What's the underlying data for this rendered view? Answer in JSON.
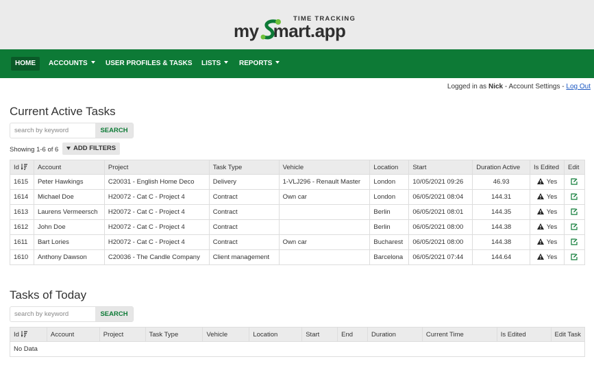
{
  "brand": {
    "tagline": "TIME TRACKING",
    "name": "mysmart.app",
    "name_prefix": "my",
    "name_suffix": "mart.app",
    "accent_color": "#0d7a36"
  },
  "nav": {
    "items": [
      {
        "label": "HOME",
        "active": true,
        "dropdown": false
      },
      {
        "label": "ACCOUNTS",
        "active": false,
        "dropdown": true
      },
      {
        "label": "USER PROFILES & TASKS",
        "active": false,
        "dropdown": false
      },
      {
        "label": "LISTS",
        "active": false,
        "dropdown": true
      },
      {
        "label": "REPORTS",
        "active": false,
        "dropdown": true
      }
    ]
  },
  "login": {
    "prefix": "Logged in as",
    "user": "Nick",
    "account_settings": "Account Settings",
    "separator": "-",
    "logout": "Log Out"
  },
  "active_tasks": {
    "title": "Current Active Tasks",
    "search_placeholder": "search by keyword",
    "search_label": "SEARCH",
    "showing": "Showing 1-6 of 6",
    "filters_label": "ADD FILTERS",
    "columns": [
      "Id",
      "Account",
      "Project",
      "Task Type",
      "Vehicle",
      "Location",
      "Start",
      "Duration Active",
      "Is Edited",
      "Edit"
    ],
    "rows": [
      {
        "id": "1615",
        "account": "Peter Hawkings",
        "project": "C20031 - English Home Deco",
        "task_type": "Delivery",
        "vehicle": "1-VLJ296 - Renault Master",
        "location": "London",
        "start": "10/05/2021 09:26",
        "duration": "46.93",
        "edited": "Yes"
      },
      {
        "id": "1614",
        "account": "Michael Doe",
        "project": "H20072 - Cat C - Project 4",
        "task_type": "Contract",
        "vehicle": "Own car",
        "location": "London",
        "start": "06/05/2021 08:04",
        "duration": "144.31",
        "edited": "Yes"
      },
      {
        "id": "1613",
        "account": "Laurens Vermeersch",
        "project": "H20072 - Cat C - Project 4",
        "task_type": "Contract",
        "vehicle": "",
        "location": "Berlin",
        "start": "06/05/2021 08:01",
        "duration": "144.35",
        "edited": "Yes"
      },
      {
        "id": "1612",
        "account": "John Doe",
        "project": "H20072 - Cat C - Project 4",
        "task_type": "Contract",
        "vehicle": "",
        "location": "Berlin",
        "start": "06/05/2021 08:00",
        "duration": "144.38",
        "edited": "Yes"
      },
      {
        "id": "1611",
        "account": "Bart Lories",
        "project": "H20072 - Cat C - Project 4",
        "task_type": "Contract",
        "vehicle": "Own car",
        "location": "Bucharest",
        "start": "06/05/2021 08:00",
        "duration": "144.38",
        "edited": "Yes"
      },
      {
        "id": "1610",
        "account": "Anthony Dawson",
        "project": "C20036 - The Candle Company",
        "task_type": "Client management",
        "vehicle": "",
        "location": "Barcelona",
        "start": "06/05/2021 07:44",
        "duration": "144.64",
        "edited": "Yes"
      }
    ]
  },
  "today_tasks": {
    "title": "Tasks of Today",
    "search_placeholder": "search by keyword",
    "search_label": "SEARCH",
    "columns": [
      "Id",
      "Account",
      "Project",
      "Task Type",
      "Vehicle",
      "Location",
      "Start",
      "End",
      "Duration",
      "Current Time",
      "Is Edited",
      "Edit Task"
    ],
    "empty_text": "No Data"
  },
  "icons": {
    "sort": "sort-desc-icon",
    "edited": "warning-icon",
    "edit": "edit-icon",
    "filter": "filter-icon",
    "caret": "caret-down-icon"
  }
}
